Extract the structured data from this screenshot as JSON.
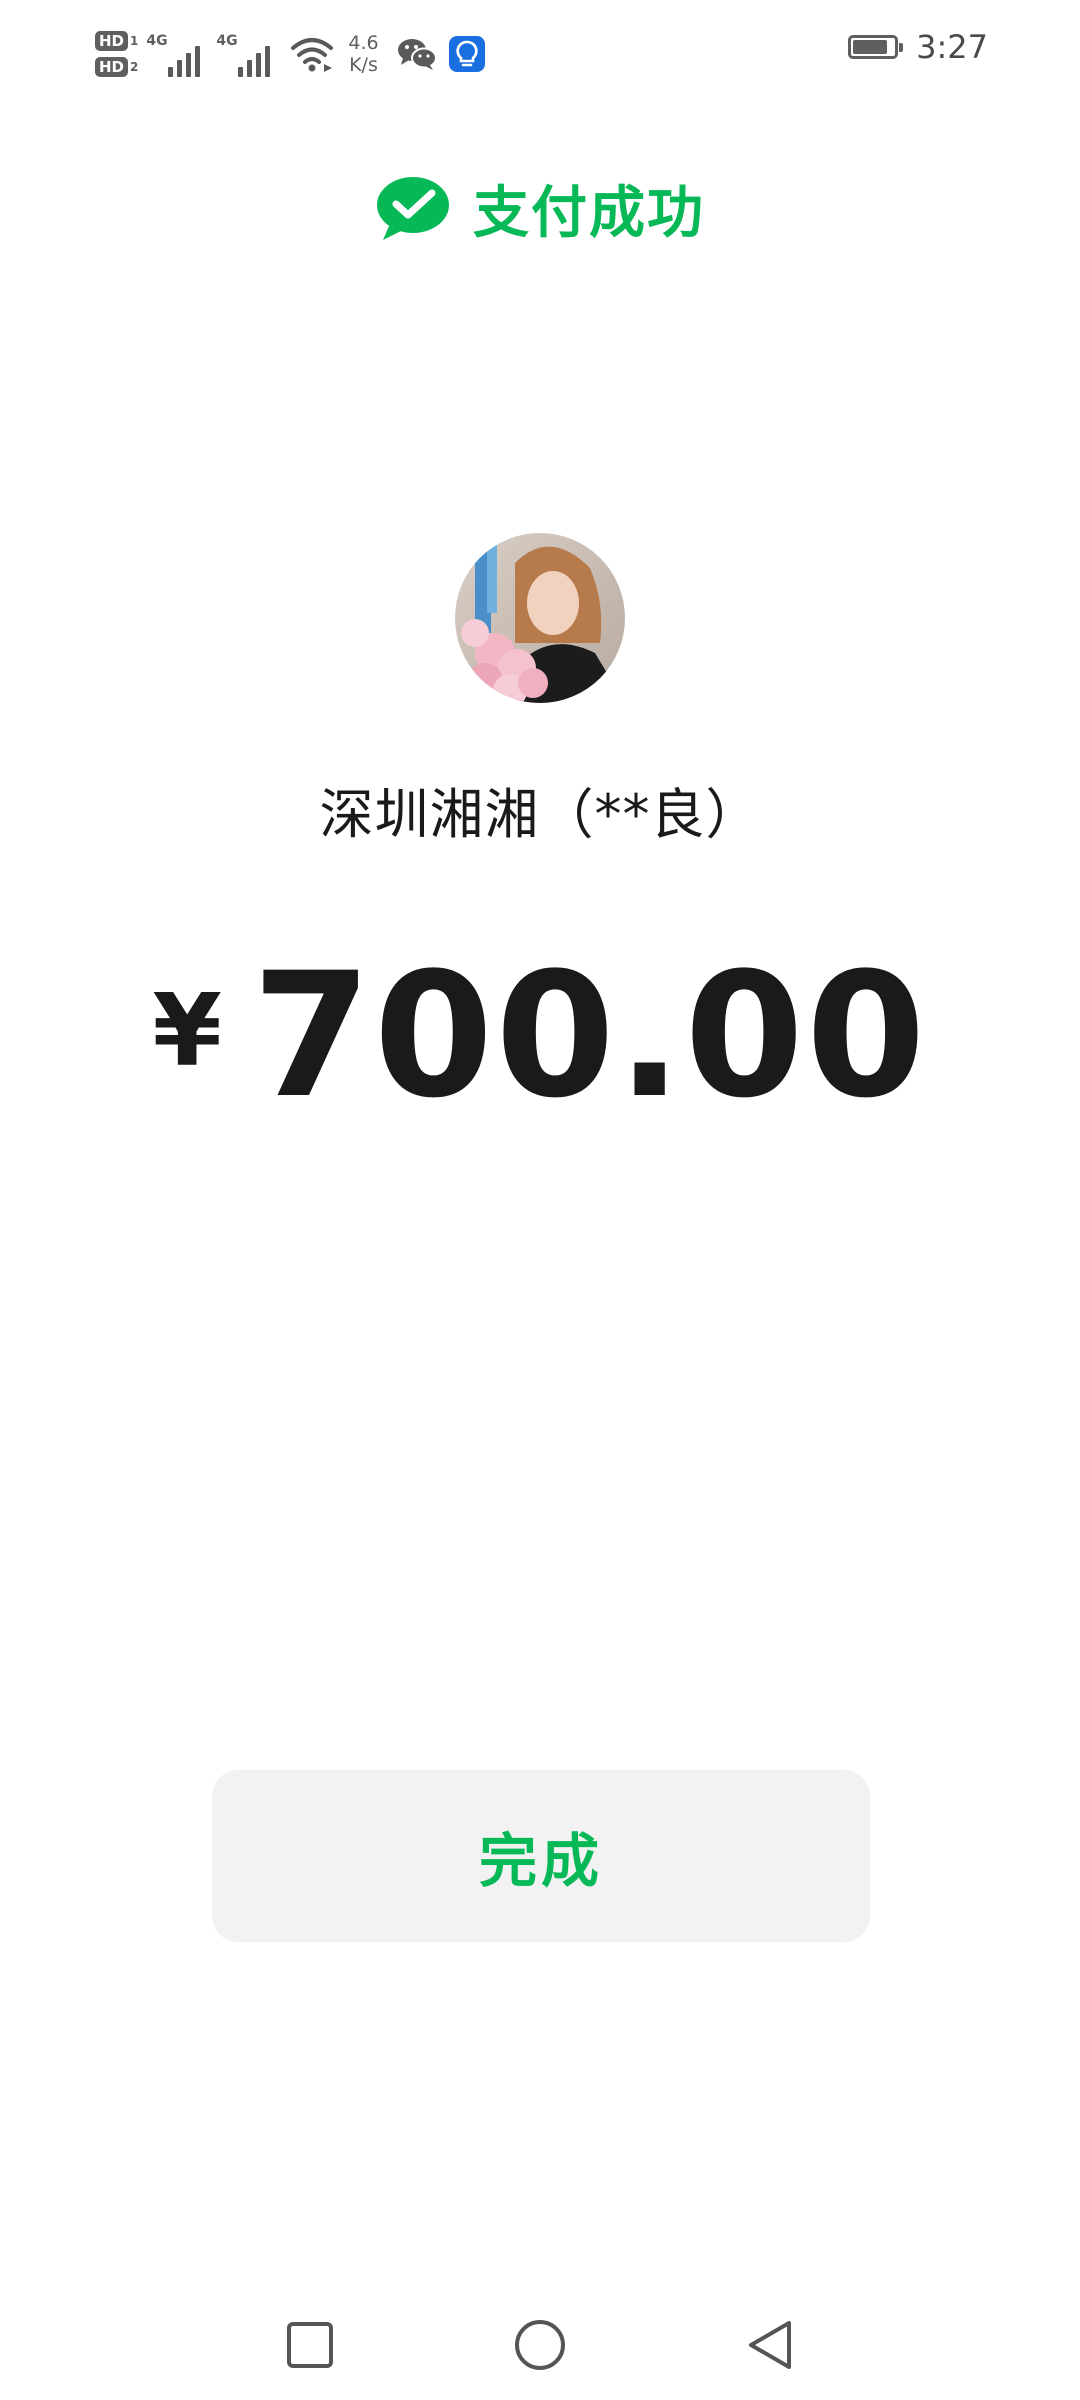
{
  "status_bar": {
    "sim1": {
      "label": "HD",
      "index": "1",
      "network": "4G"
    },
    "sim2": {
      "label": "HD",
      "index": "2",
      "network": "4G"
    },
    "speed_value": "4.6",
    "speed_unit": "K/s",
    "battery_level": 0.85,
    "time": "3:27",
    "icons": [
      "hd-icon",
      "signal-icon",
      "wifi-icon",
      "wechat-icon",
      "bulb-icon",
      "battery-icon"
    ]
  },
  "header": {
    "title": "支付成功",
    "icon": "wechat-pay-check-icon"
  },
  "payee": {
    "name": "深圳湘湘（**良）"
  },
  "amount": {
    "currency": "¥",
    "value": "700.00"
  },
  "actions": {
    "done_label": "完成"
  },
  "nav_bar": {
    "items": [
      "recents-square-icon",
      "home-circle-icon",
      "back-triangle-icon"
    ]
  },
  "colors": {
    "brand_green": "#07b857",
    "text_primary": "#1a1a1a",
    "button_bg": "#f2f2f2",
    "status_gray": "#5f5f5f",
    "notif_blue": "#1a6fe0"
  }
}
